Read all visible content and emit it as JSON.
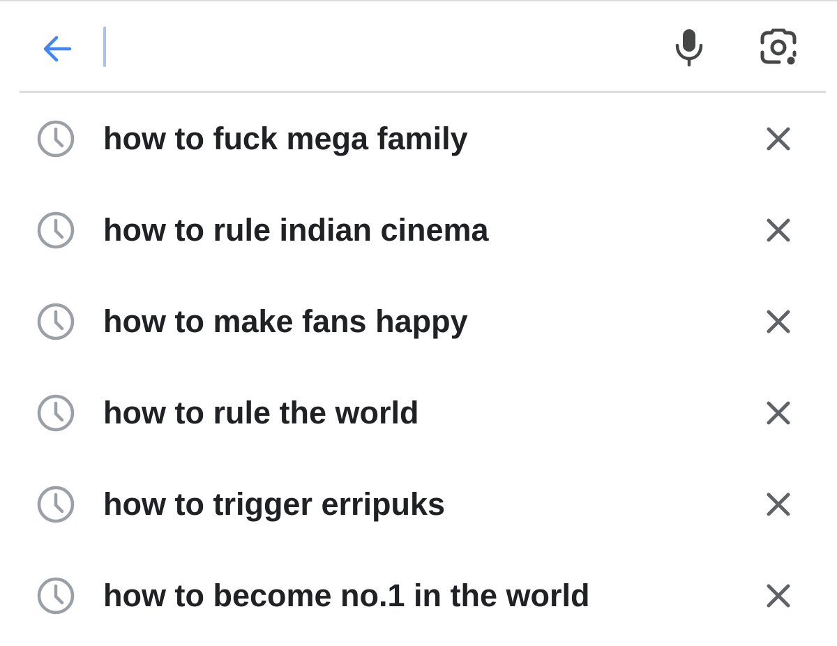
{
  "search": {
    "value": "",
    "placeholder": ""
  },
  "icons": {
    "back": "arrow-left-icon",
    "voice": "microphone-icon",
    "lens": "camera-lens-icon",
    "history": "clock-icon",
    "remove": "close-icon"
  },
  "colors": {
    "accent": "#4285f4",
    "caret": "#aac3ea",
    "icon_dark": "#444746",
    "icon_light": "#9aa0a6",
    "text": "#202124",
    "divider": "#dadce0"
  },
  "suggestions": [
    {
      "text": "how to fuck mega family"
    },
    {
      "text": "how to rule indian cinema"
    },
    {
      "text": "how to make fans happy"
    },
    {
      "text": "how to rule the world"
    },
    {
      "text": "how to trigger erripuks"
    },
    {
      "text": "how to become no.1 in the world"
    }
  ]
}
